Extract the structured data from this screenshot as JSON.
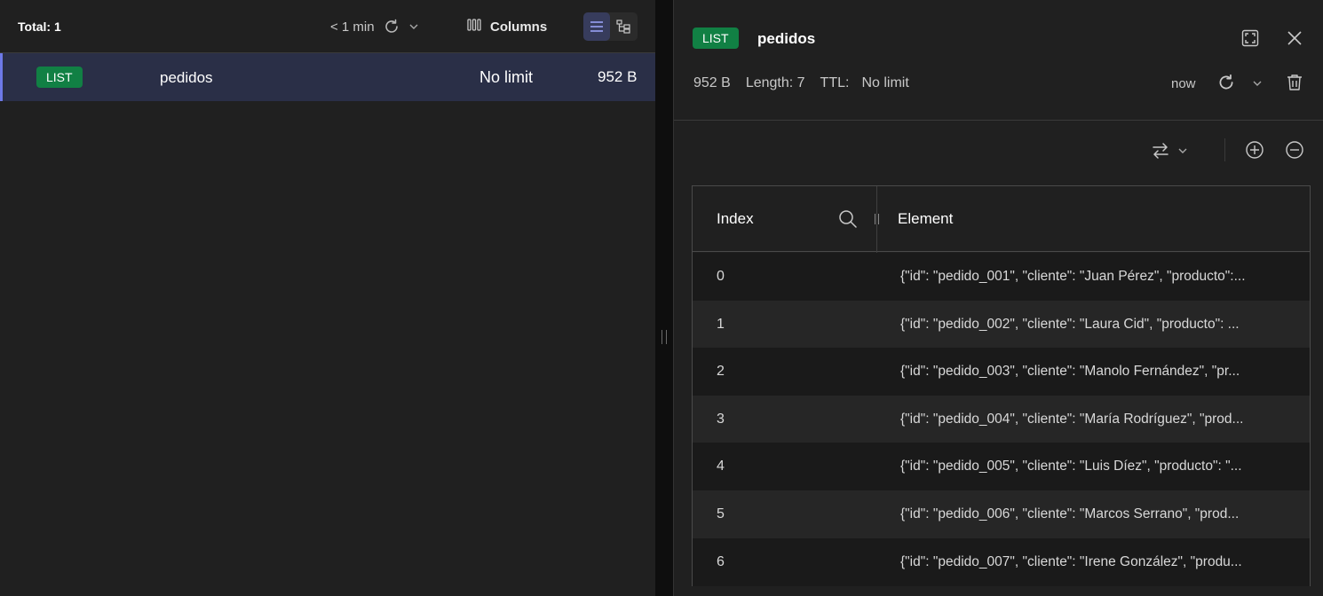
{
  "keys_panel": {
    "total_label": "Total: 1",
    "refresh_time": "< 1 min",
    "columns_label": "Columns",
    "rows": [
      {
        "type": "LIST",
        "name": "pedidos",
        "ttl": "No limit",
        "size": "952 B"
      }
    ]
  },
  "details_panel": {
    "key_type": "LIST",
    "key_name": "pedidos",
    "size": "952 B",
    "length": "Length: 7",
    "ttl_label": "TTL:",
    "ttl_value": "No limit",
    "last_refresh": "now",
    "table": {
      "headers": {
        "index": "Index",
        "element": "Element"
      },
      "rows": [
        {
          "index": "0",
          "element": "{\"id\": \"pedido_001\", \"cliente\": \"Juan Pérez\", \"producto\":..."
        },
        {
          "index": "1",
          "element": "{\"id\": \"pedido_002\", \"cliente\": \"Laura Cid\", \"producto\": ..."
        },
        {
          "index": "2",
          "element": "{\"id\": \"pedido_003\", \"cliente\": \"Manolo Fernández\", \"pr..."
        },
        {
          "index": "3",
          "element": "{\"id\": \"pedido_004\", \"cliente\": \"María Rodríguez\", \"prod..."
        },
        {
          "index": "4",
          "element": "{\"id\": \"pedido_005\", \"cliente\": \"Luis Díez\", \"producto\": \"..."
        },
        {
          "index": "5",
          "element": "{\"id\": \"pedido_006\", \"cliente\": \"Marcos Serrano\", \"prod..."
        },
        {
          "index": "6",
          "element": "{\"id\": \"pedido_007\", \"cliente\": \"Irene González\", \"produ..."
        }
      ]
    }
  },
  "colors": {
    "badge_list": "#118044",
    "selected_row": "#2a2f47",
    "selected_accent": "#6d79e8",
    "panel_bg": "#202020"
  },
  "icons": [
    "refresh-icon",
    "chevron-down-icon",
    "columns-icon",
    "list-view-icon",
    "tree-view-icon",
    "maximize-icon",
    "close-icon",
    "trash-icon",
    "swap-icon",
    "add-circle-icon",
    "remove-circle-icon",
    "search-icon"
  ]
}
